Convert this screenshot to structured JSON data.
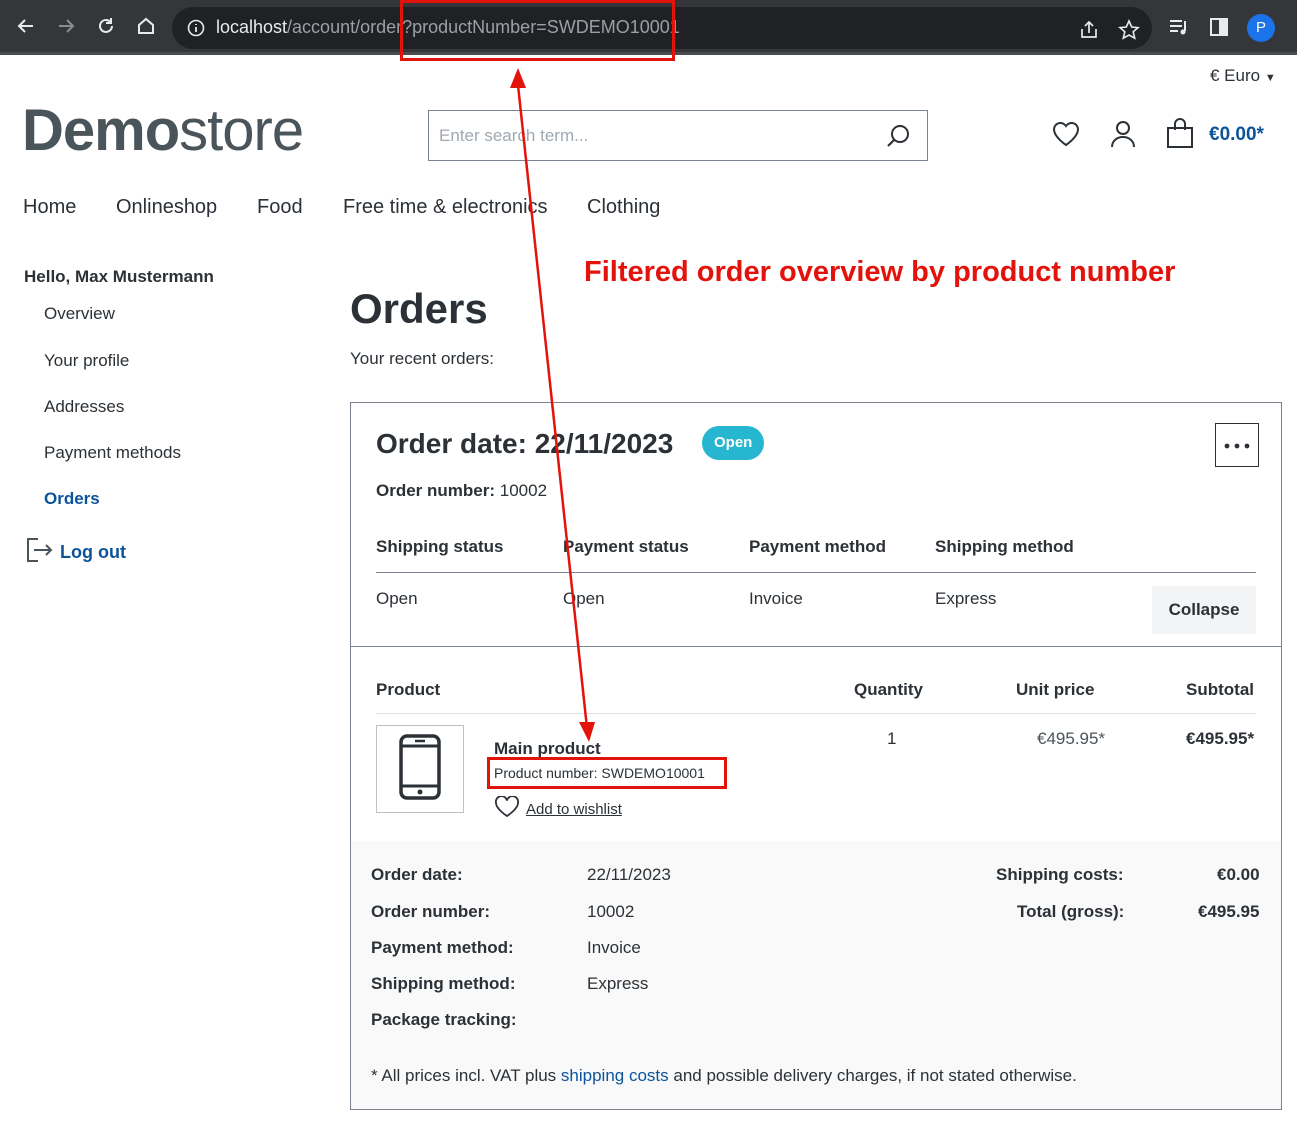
{
  "browser": {
    "url_host": "localhost",
    "url_path": "/account/order?productNumber=SWDEMO10001",
    "profile_initial": "P"
  },
  "header": {
    "currency": "€ Euro",
    "logo_bold": "Demo",
    "logo_light": "store",
    "search_placeholder": "Enter search term...",
    "cart_total": "€0.00*"
  },
  "nav": [
    "Home",
    "Onlineshop",
    "Food",
    "Free time & electronics",
    "Clothing"
  ],
  "sidebar": {
    "greeting": "Hello, Max Mustermann",
    "items": [
      "Overview",
      "Your profile",
      "Addresses",
      "Payment methods",
      "Orders"
    ],
    "active_item": "Orders",
    "logout": "Log out"
  },
  "annotation": {
    "title": "Filtered order overview by product number"
  },
  "page": {
    "title": "Orders",
    "subtitle": "Your recent orders:"
  },
  "order": {
    "date_heading": "Order date: 22/11/2023",
    "status_badge": "Open",
    "number_label": "Order number:",
    "number_value": "10002",
    "status_headers": [
      "Shipping status",
      "Payment status",
      "Payment method",
      "Shipping method"
    ],
    "status_values": [
      "Open",
      "Open",
      "Invoice",
      "Express"
    ],
    "collapse_label": "Collapse",
    "product_headers": [
      "Product",
      "Quantity",
      "Unit price",
      "Subtotal"
    ],
    "product": {
      "name": "Main product",
      "number": "Product number: SWDEMO10001",
      "wishlist": "Add to wishlist",
      "quantity": "1",
      "unit_price": "€495.95*",
      "subtotal": "€495.95*"
    },
    "details": [
      {
        "label": "Order date:",
        "value": "22/11/2023"
      },
      {
        "label": "Order number:",
        "value": "10002"
      },
      {
        "label": "Payment method:",
        "value": "Invoice"
      },
      {
        "label": "Shipping method:",
        "value": "Express"
      },
      {
        "label": "Package tracking:",
        "value": ""
      }
    ],
    "summary": [
      {
        "label": "Shipping costs:",
        "value": "€0.00"
      },
      {
        "label": "Total (gross):",
        "value": "€495.95"
      }
    ],
    "vat_before": "* All prices incl. VAT plus ",
    "vat_link": "shipping costs",
    "vat_after": " and possible delivery charges, if not stated otherwise."
  },
  "colors": {
    "accent_blue": "#0b539b",
    "badge": "#26b6cf",
    "annotation_red": "#e3120b"
  }
}
